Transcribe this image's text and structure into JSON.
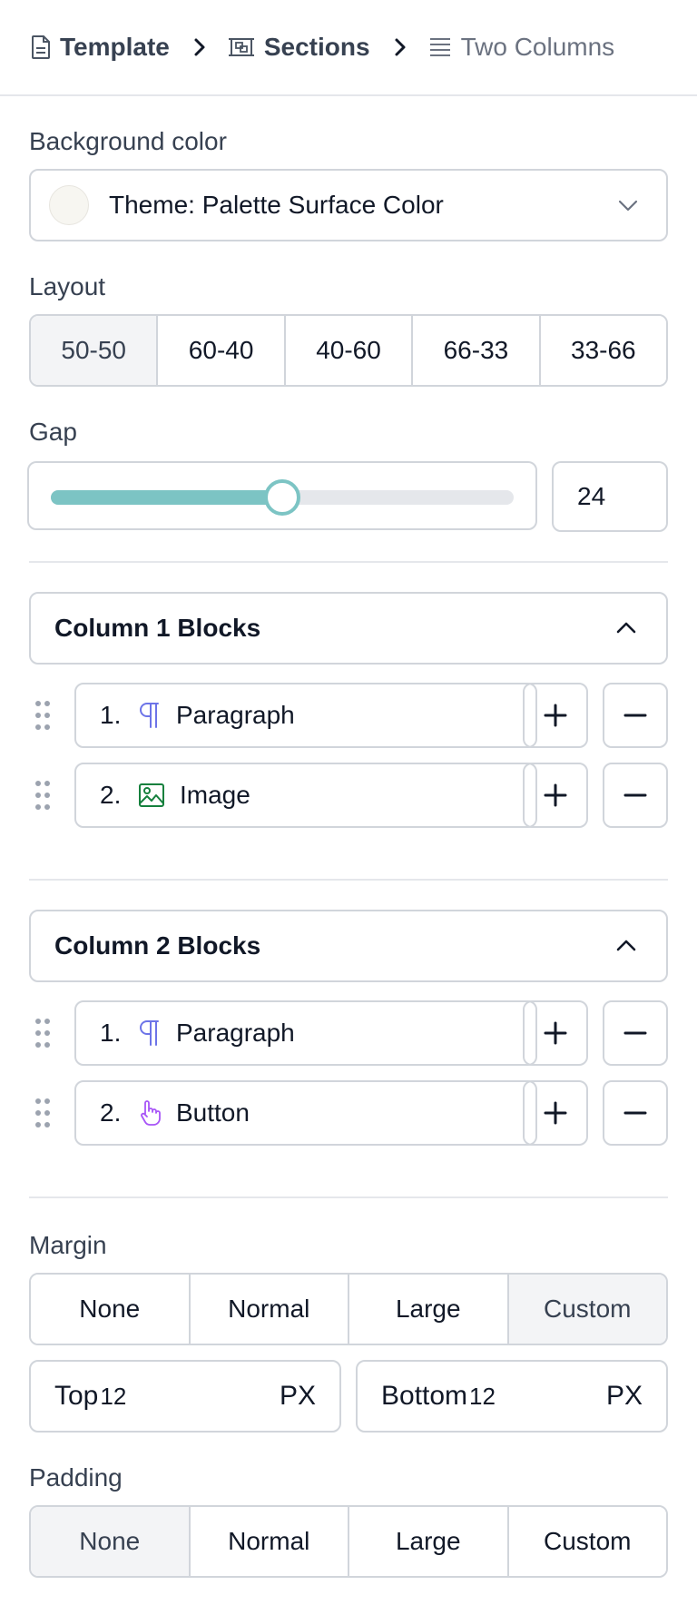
{
  "breadcrumb": {
    "items": [
      {
        "label": "Template",
        "icon": "document-icon"
      },
      {
        "label": "Sections",
        "icon": "sections-icon"
      },
      {
        "label": "Two Columns",
        "icon": "lines-icon"
      }
    ]
  },
  "background": {
    "label": "Background color",
    "value": "Theme: Palette Surface Color",
    "swatch_color": "#f7f6f1"
  },
  "layout": {
    "label": "Layout",
    "options": [
      "50-50",
      "60-40",
      "40-60",
      "66-33",
      "33-66"
    ],
    "selected": "50-50"
  },
  "gap": {
    "label": "Gap",
    "value": "24",
    "slider_fraction": 0.5,
    "accent": "#7cc4c4"
  },
  "column1": {
    "title": "Column 1 Blocks",
    "blocks": [
      {
        "index": "1.",
        "name": "Paragraph",
        "icon": "paragraph-icon"
      },
      {
        "index": "2.",
        "name": "Image",
        "icon": "image-icon"
      }
    ]
  },
  "column2": {
    "title": "Column 2 Blocks",
    "blocks": [
      {
        "index": "1.",
        "name": "Paragraph",
        "icon": "paragraph-icon"
      },
      {
        "index": "2.",
        "name": "Button",
        "icon": "hand-pointer-icon"
      }
    ]
  },
  "margin": {
    "label": "Margin",
    "options": [
      "None",
      "Normal",
      "Large",
      "Custom"
    ],
    "selected": "Custom",
    "top": {
      "label": "Top",
      "value": "12",
      "unit": "PX"
    },
    "bottom": {
      "label": "Bottom",
      "value": "12",
      "unit": "PX"
    }
  },
  "padding": {
    "label": "Padding",
    "options": [
      "None",
      "Normal",
      "Large",
      "Custom"
    ],
    "selected": "None"
  }
}
